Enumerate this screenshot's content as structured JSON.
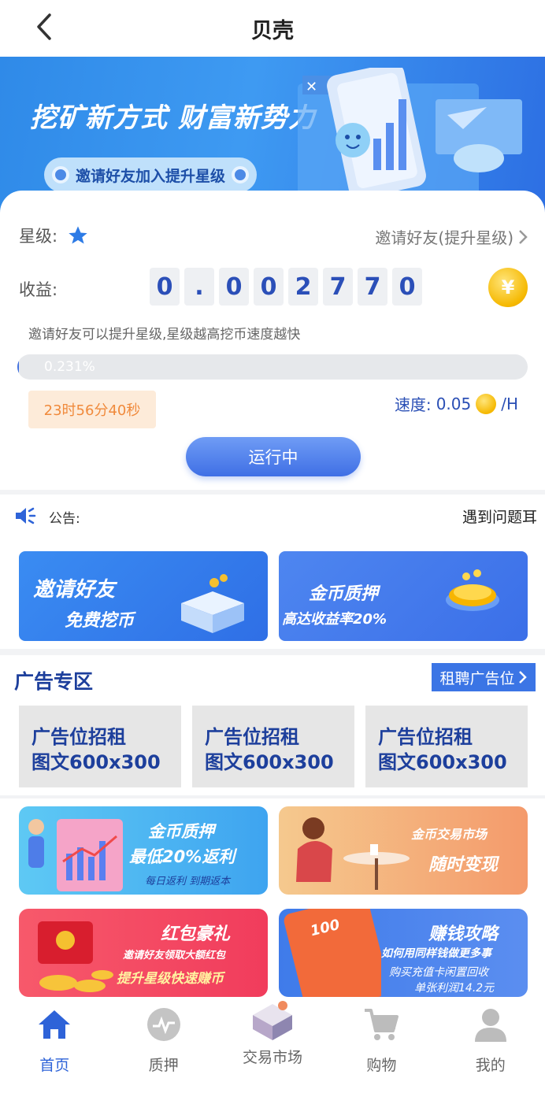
{
  "nav": {
    "title": "贝壳"
  },
  "banner": {
    "slogan": "挖矿新方式 财富新势力",
    "pill": "邀请好友加入提升星级"
  },
  "mining": {
    "star_label": "星级:",
    "invite_link": "邀请好友(提升星级)",
    "earn_label": "收益:",
    "digits": [
      "0",
      ".",
      "0",
      "0",
      "2",
      "7",
      "7",
      "0"
    ],
    "coin_symbol": "¥",
    "hint": "邀请好友可以提升星级,星级越高挖币速度越快",
    "progress_text": "0.231%",
    "progress_value": 0.00231,
    "timer": "23时56分40秒",
    "speed_label": "速度:",
    "speed_value": "0.05",
    "speed_unit": "/H",
    "run_button": "运行中"
  },
  "notice": {
    "label": "公告:",
    "text": "遇到问题耳"
  },
  "promos": [
    {
      "line1": "邀请好友",
      "line2": "免费挖币"
    },
    {
      "line1": "金币质押",
      "line2": "高达收益率20%"
    }
  ],
  "adzone": {
    "title": "广告专区",
    "rent_button": "租聘广告位",
    "slots": [
      {
        "line1": "广告位招租",
        "line2": "图文600x300"
      },
      {
        "line1": "广告位招租",
        "line2": "图文600x300"
      },
      {
        "line1": "广告位招租",
        "line2": "图文600x300"
      }
    ]
  },
  "tiles": {
    "a": {
      "title": "金币质押",
      "sub": "最低20%返利",
      "note": "每日返利 到期返本"
    },
    "b": {
      "title": "金币交易市场",
      "sub": "随时变现"
    },
    "c": {
      "title": "红包豪礼",
      "sub": "邀请好友领取大额红包",
      "note": "提升星级快速赚币"
    },
    "d": {
      "title": "赚钱攻略",
      "sub": "如何用同样钱做更多事",
      "note": "购买充值卡闲置回收",
      "note2": "单张利润14.2元",
      "card": "100"
    }
  },
  "tabbar": [
    {
      "label": "首页",
      "icon": "home-icon",
      "active": true
    },
    {
      "label": "质押",
      "icon": "pledge-icon",
      "active": false
    },
    {
      "label": "交易市场",
      "icon": "market-icon",
      "active": false
    },
    {
      "label": "购物",
      "icon": "cart-icon",
      "active": false
    },
    {
      "label": "我的",
      "icon": "user-icon",
      "active": false
    }
  ],
  "colors": {
    "primary": "#3f6fe0",
    "ad_text": "#1d3f9c",
    "timer_text": "#f08a3c",
    "timer_bg": "#fdebd9"
  }
}
